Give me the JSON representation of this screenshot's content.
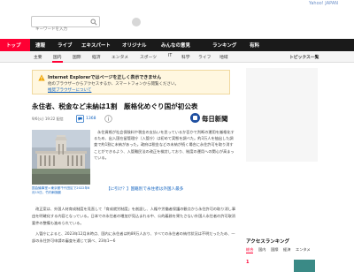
{
  "header": {
    "brand": "Yahoo! JAPAN"
  },
  "search": {
    "placeholder": "キーワードを入力"
  },
  "nav_main": {
    "items": [
      "トップ",
      "速報",
      "ライブ",
      "エキスパート",
      "オリジナル",
      "みんなの意見",
      "ランキング",
      "有料"
    ]
  },
  "nav_sub": {
    "items": [
      "主要",
      "国内",
      "国際",
      "経済",
      "エンタメ",
      "スポーツ",
      "IT",
      "科学",
      "ライフ",
      "地域",
      "トピックス一覧"
    ]
  },
  "alert": {
    "title": "Internet Explorerではページを正しく表示できません",
    "line2": "他のブラウザーからアクセスするか、スマートフォンから閲覧ください。",
    "link": "推奨ブラウザーについて"
  },
  "article": {
    "headline": "永住者、税金など未納は1割　厳格化めぐり国が初公表",
    "date": "9/6(火) 19:22 配信",
    "comment_count": "1368",
    "publisher": "毎日新聞",
    "caption": "国会議事堂＝東京都千代田区で2022年6月15日、竹内幹撮影",
    "intro": "永住資格が社会保険料や税金の支払いを怠っているか否かで判断の運用を厳格化するため、出入国在留管理庁（入管庁）は初めて実態を調べた。約3万人を抽出した調査で約1割に未納があった。政府は税金などの未納が続く場合に永住許可を取り消すことができるよう、入管難民法の改正を検討しており、制度の運用への関心が高まっている。",
    "related_link": "【に引け？】国籍別で永住者は外国人最多",
    "para1": "改正案は、外国人材育成制度を見直して「育成就労制度」を創設し、人権や労働者保護の観点から永住許可の取り消し事由を明確化する内容となっている。日本での永住者の増加が見込まれる中、公的義務を果たさない外国人永住者の許可取消要件の整備も進められている。",
    "para2": "入管庁によると、2023年12月末時点、国内に永住者は約89万人おり、すべての永住者の納付状況は不明だったため、一部の永住許可申請の審査を通じて調べ、23年1〜6"
  },
  "sidebar": {
    "ranking_title": "アクセスランキング",
    "ranking_tabs": [
      "総合",
      "国内",
      "国際",
      "経済",
      "エンタメ"
    ],
    "first_rank": "1"
  }
}
